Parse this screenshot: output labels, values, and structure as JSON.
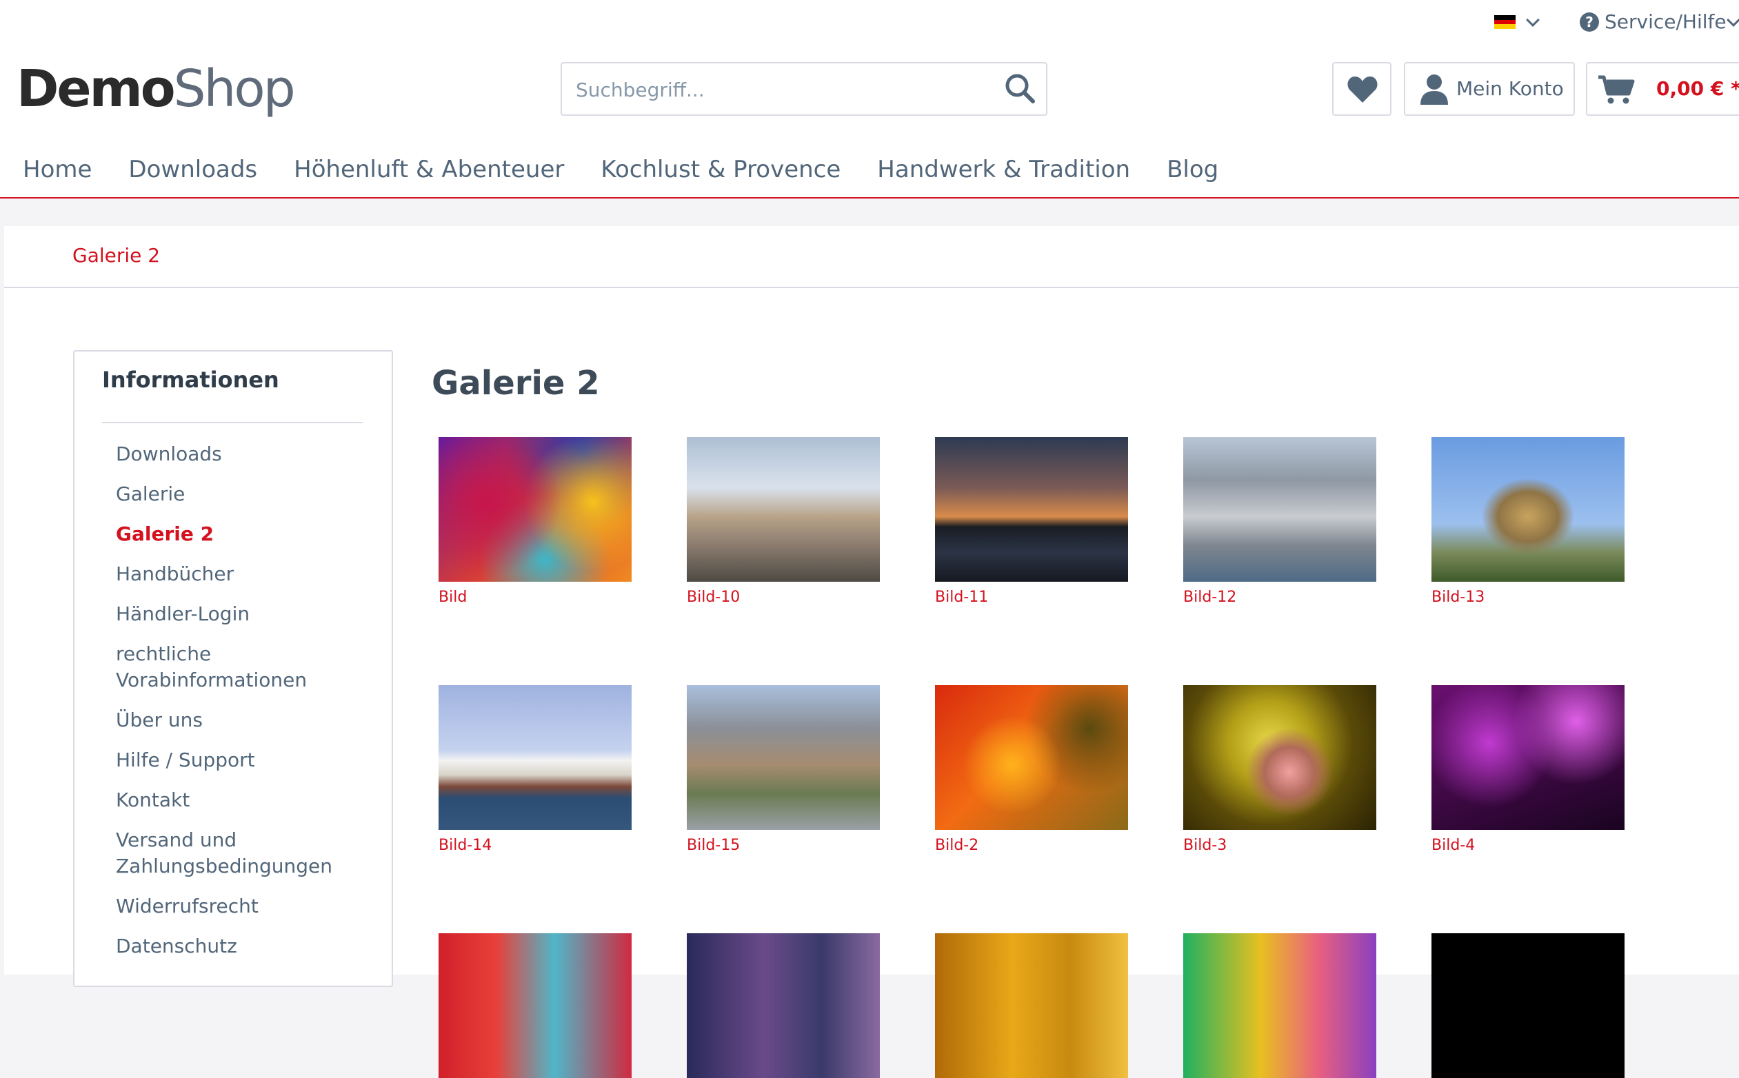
{
  "topbar": {
    "language": "de",
    "service_label": "Service/Hilfe"
  },
  "header": {
    "logo": {
      "part1": "Demo",
      "part2": "Shop"
    },
    "search": {
      "placeholder": "Suchbegriff..."
    },
    "account_label": "Mein Konto",
    "cart_total": "0,00 € *"
  },
  "nav": {
    "items": [
      "Home",
      "Downloads",
      "Höhenluft & Abenteuer",
      "Kochlust & Provence",
      "Handwerk & Tradition",
      "Blog"
    ]
  },
  "breadcrumb": {
    "current": "Galerie 2"
  },
  "sidebar": {
    "title": "Informationen",
    "items": [
      "Downloads",
      "Galerie",
      "Galerie 2",
      "Handbücher",
      "Händler-Login",
      "rechtliche Vorabinformationen",
      "Über uns",
      "Hilfe / Support",
      "Kontakt",
      "Versand und Zahlungsbedingungen",
      "Widerrufsrecht",
      "Datenschutz"
    ],
    "active": "Galerie 2"
  },
  "main": {
    "title": "Galerie 2",
    "gallery": [
      {
        "label": "Bild"
      },
      {
        "label": "Bild-10"
      },
      {
        "label": "Bild-11"
      },
      {
        "label": "Bild-12"
      },
      {
        "label": "Bild-13"
      },
      {
        "label": "Bild-14"
      },
      {
        "label": "Bild-15"
      },
      {
        "label": "Bild-2"
      },
      {
        "label": "Bild-3"
      },
      {
        "label": "Bild-4"
      },
      {
        "label": ""
      },
      {
        "label": ""
      },
      {
        "label": ""
      },
      {
        "label": ""
      },
      {
        "label": ""
      }
    ]
  },
  "colors": {
    "accent": "#d4111e",
    "text": "#52667a",
    "border": "#dadae5",
    "background": "#f4f4f7"
  }
}
